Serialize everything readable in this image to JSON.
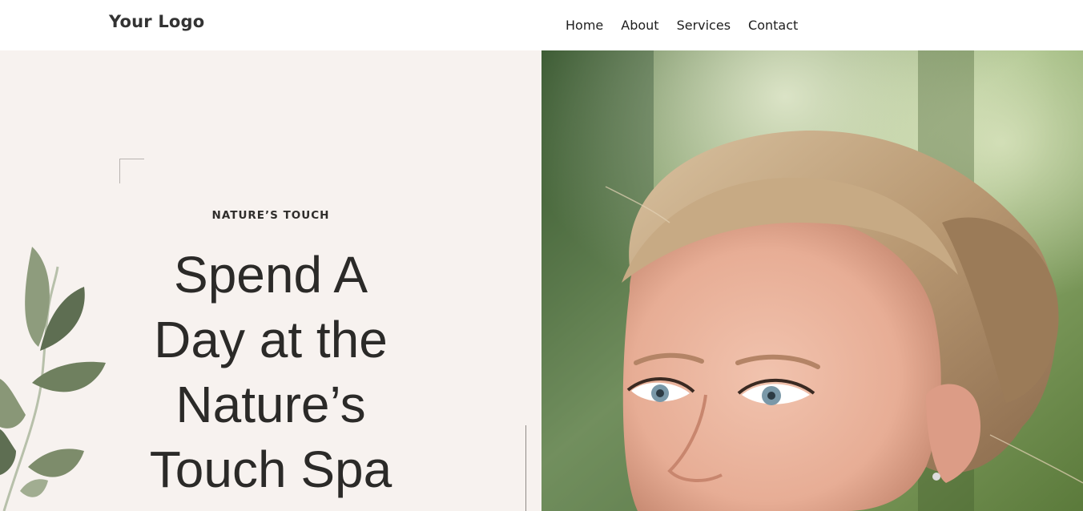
{
  "header": {
    "logo": "Your Logo",
    "nav": [
      "Home",
      "About",
      "Services",
      "Contact"
    ]
  },
  "hero": {
    "eyebrow": "NATURE’S TOUCH",
    "headline_lines": [
      "Spend A",
      "Day at the",
      "Nature’s",
      "Touch Spa"
    ]
  },
  "icons": {
    "leaf_illustration": "leaf-branch-icon",
    "corner_frame": "corner-frame-icon"
  },
  "colors": {
    "panel_bg": "#f7f2ef",
    "text": "#2b2a28",
    "leaf": "#8a9a78"
  }
}
